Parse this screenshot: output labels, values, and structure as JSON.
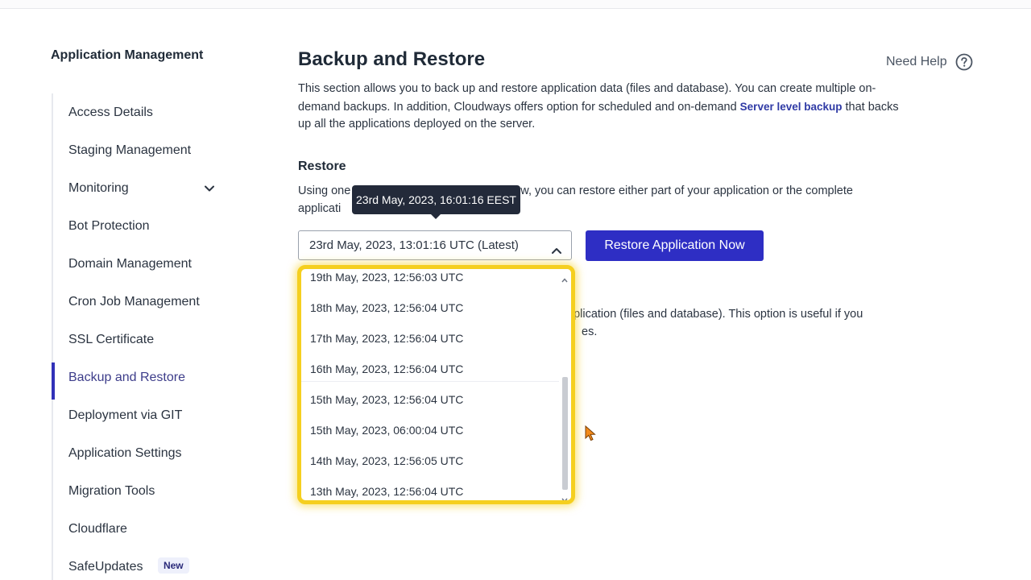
{
  "sidebar": {
    "title": "Application Management",
    "items": [
      {
        "label": "Access Details"
      },
      {
        "label": "Staging Management"
      },
      {
        "label": "Monitoring"
      },
      {
        "label": "Bot Protection"
      },
      {
        "label": "Domain Management"
      },
      {
        "label": "Cron Job Management"
      },
      {
        "label": "SSL Certificate"
      },
      {
        "label": "Backup and Restore"
      },
      {
        "label": "Deployment via GIT"
      },
      {
        "label": "Application Settings"
      },
      {
        "label": "Migration Tools"
      },
      {
        "label": "Cloudflare"
      },
      {
        "label": "SafeUpdates",
        "badge": "New"
      }
    ],
    "active_index": 7
  },
  "header": {
    "title": "Backup and Restore",
    "help_label": "Need Help"
  },
  "intro": {
    "text_before_link": "This section allows you to back up and restore application data (files and database). You can create multiple on-demand backups. In addition, Cloudways offers option for scheduled and on-demand ",
    "link_text": "Server level backup",
    "text_after_link": " that backs up all the applications deployed on the server."
  },
  "restore": {
    "title": "Restore",
    "desc_part1": "Using one",
    "desc_part2": "w, you can restore either part of your application or the complete",
    "desc_line2": "applicati",
    "tooltip": "23rd May, 2023, 16:01:16 EEST",
    "selected": "23rd May, 2023, 13:01:16 UTC (Latest)",
    "button_label": "Restore Application Now",
    "options": [
      "19th May, 2023, 12:56:03 UTC",
      "18th May, 2023, 12:56:04 UTC",
      "17th May, 2023, 12:56:04 UTC",
      "16th May, 2023, 12:56:04 UTC",
      "15th May, 2023, 12:56:04 UTC",
      "15th May, 2023, 06:00:04 UTC",
      "14th May, 2023, 12:56:05 UTC",
      "13th May, 2023, 12:56:04 UTC"
    ]
  },
  "backup": {
    "desc_line1": "pplication (files and database). This option is useful if you",
    "desc_line2": "es."
  },
  "colors": {
    "accent": "#2e2ec4",
    "highlight": "#f5cf1f",
    "tooltip_bg": "#232a3a"
  }
}
